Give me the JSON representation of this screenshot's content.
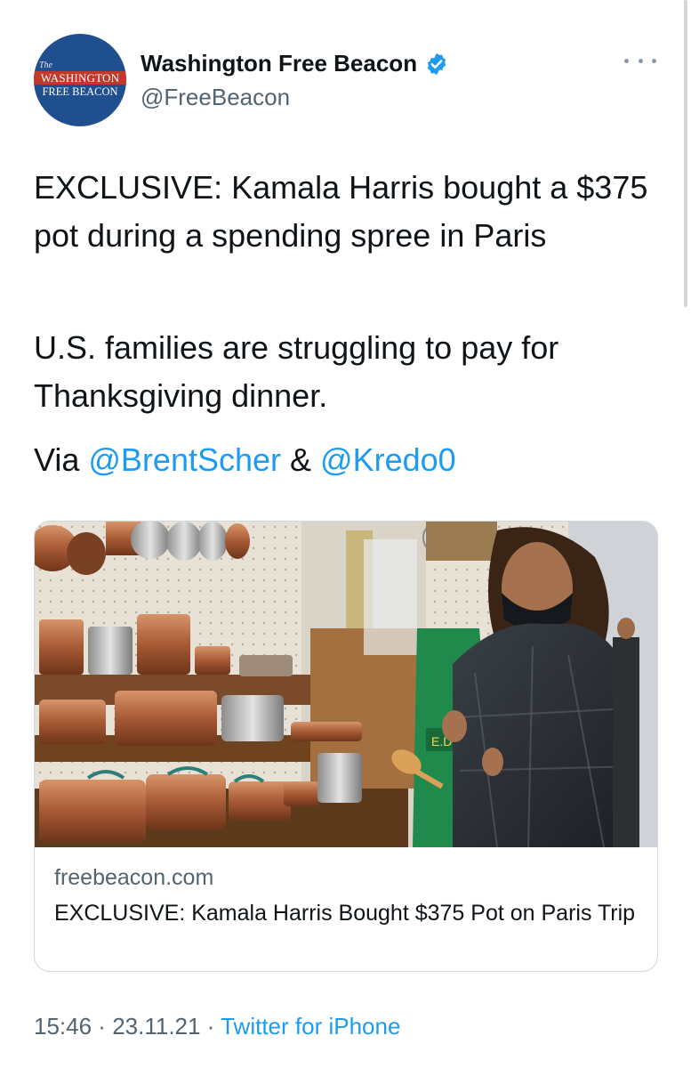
{
  "account": {
    "avatar": {
      "line_top": "The",
      "line_mid": "WASHINGTON",
      "line_bottom": "FREE BEACON"
    },
    "display_name": "Washington Free Beacon",
    "handle": "@FreeBeacon"
  },
  "tweet": {
    "paragraph1": "EXCLUSIVE: Kamala Harris bought a $375 pot during a spending spree in Paris",
    "paragraph2": "U.S. families are struggling to pay for Thanksgiving dinner.",
    "via_prefix": "Via ",
    "mention1": "@BrentScher",
    "ampersand": " & ",
    "mention2": "@Kredo0"
  },
  "card": {
    "domain": "freebeacon.com",
    "title": "EXCLUSIVE: Kamala Harris Bought $375 Pot on Paris Trip",
    "apron_text": "E.D"
  },
  "footer": {
    "time": "15:46",
    "separator": " · ",
    "date": "23.11.21",
    "source": "Twitter for iPhone"
  },
  "colors": {
    "link": "#1d9bf0",
    "verified_badge": "#1d9bf0",
    "avatar_bg": "#1f4f8f",
    "avatar_band": "#c0392b"
  },
  "icons": {
    "verified": "verified-badge-icon",
    "more": "more-options-icon"
  }
}
